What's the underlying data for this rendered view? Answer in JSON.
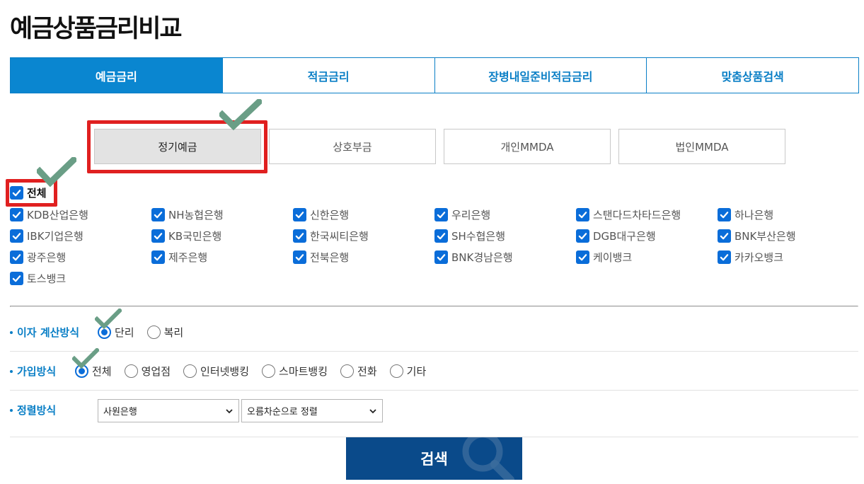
{
  "page": {
    "title": "예금상품금리비교"
  },
  "main_tabs": [
    {
      "label": "예금금리",
      "active": true
    },
    {
      "label": "적금금리",
      "active": false
    },
    {
      "label": "장병내일준비적금금리",
      "active": false
    },
    {
      "label": "맞춤상품검색",
      "active": false
    }
  ],
  "sub_tabs": [
    {
      "label": "정기예금",
      "active": true
    },
    {
      "label": "상호부금",
      "active": false
    },
    {
      "label": "개인MMDA",
      "active": false
    },
    {
      "label": "법인MMDA",
      "active": false
    }
  ],
  "banks": {
    "all_label": "전체",
    "all_checked": true,
    "rows": [
      [
        "KDB산업은행",
        "NH농협은행",
        "신한은행",
        "우리은행",
        "스탠다드차타드은행",
        "하나은행"
      ],
      [
        "IBK기업은행",
        "KB국민은행",
        "한국씨티은행",
        "SH수협은행",
        "DGB대구은행",
        "BNK부산은행"
      ],
      [
        "광주은행",
        "제주은행",
        "전북은행",
        "BNK경남은행",
        "케이뱅크",
        "카카오뱅크"
      ],
      [
        "토스뱅크"
      ]
    ]
  },
  "interest_method": {
    "label": "이자 계산방식",
    "options": [
      {
        "label": "단리",
        "selected": true
      },
      {
        "label": "복리",
        "selected": false
      }
    ]
  },
  "join_method": {
    "label": "가입방식",
    "options": [
      {
        "label": "전체",
        "selected": true
      },
      {
        "label": "영업점",
        "selected": false
      },
      {
        "label": "인터넷뱅킹",
        "selected": false
      },
      {
        "label": "스마트뱅킹",
        "selected": false
      },
      {
        "label": "전화",
        "selected": false
      },
      {
        "label": "기타",
        "selected": false
      }
    ]
  },
  "sort_method": {
    "label": "정렬방식",
    "select1": "사원은행",
    "select2": "오름차순으로 정렬"
  },
  "search_button": {
    "label": "검색"
  },
  "colors": {
    "accent": "#0a86d0",
    "highlight": "#e02020",
    "check_mark": "#6a9e86",
    "search_bg": "#0a4a8a"
  }
}
